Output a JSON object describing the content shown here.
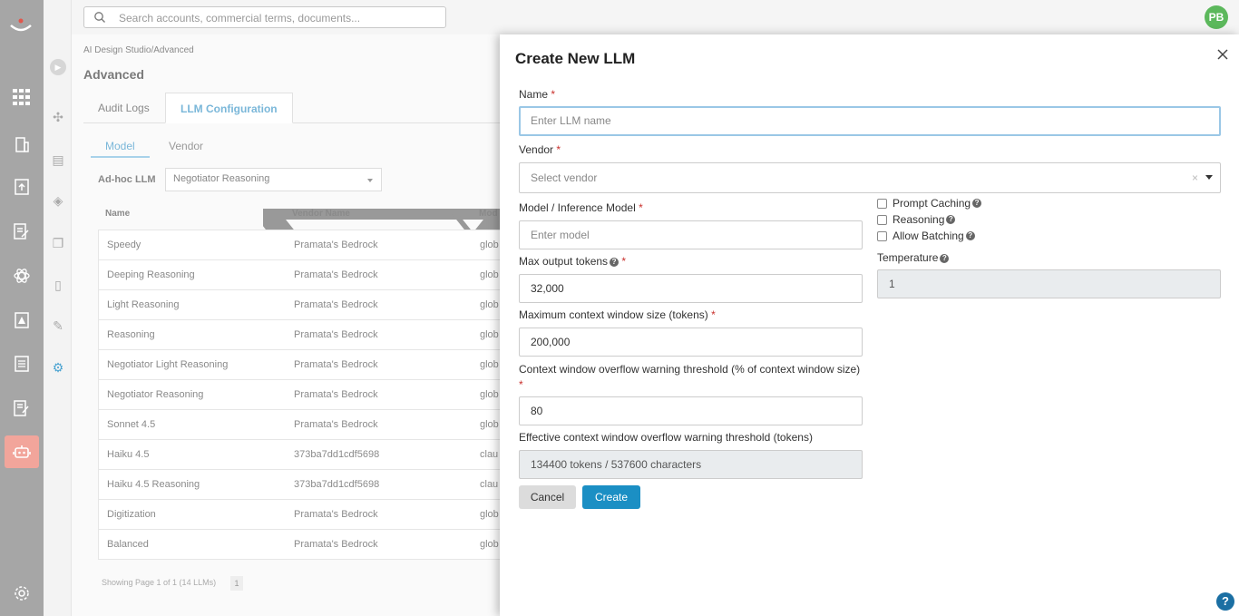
{
  "search": {
    "placeholder": "Search accounts, commercial terms, documents..."
  },
  "user": {
    "initials": "PB"
  },
  "breadcrumb": "AI Design Studio/Advanced",
  "page_title": "Advanced",
  "tabs": [
    {
      "label": "Audit Logs"
    },
    {
      "label": "LLM Configuration"
    }
  ],
  "subtabs": [
    {
      "label": "Model"
    },
    {
      "label": "Vendor"
    }
  ],
  "adhoc": {
    "label": "Ad-hoc LLM",
    "value": "Negotiator Reasoning"
  },
  "table": {
    "headers": [
      "Name",
      "Vendor Name",
      "Mod"
    ],
    "rows": [
      {
        "name": "Speedy",
        "vendor": "Pramata's Bedrock",
        "model": "glob"
      },
      {
        "name": "Deeping Reasoning",
        "vendor": "Pramata's Bedrock",
        "model": "glob"
      },
      {
        "name": "Light Reasoning",
        "vendor": "Pramata's Bedrock",
        "model": "glob"
      },
      {
        "name": "Reasoning",
        "vendor": "Pramata's Bedrock",
        "model": "glob"
      },
      {
        "name": "Negotiator Light Reasoning",
        "vendor": "Pramata's Bedrock",
        "model": "glob"
      },
      {
        "name": "Negotiator Reasoning",
        "vendor": "Pramata's Bedrock",
        "model": "glob"
      },
      {
        "name": "Sonnet 4.5",
        "vendor": "Pramata's Bedrock",
        "model": "glob"
      },
      {
        "name": "Haiku 4.5",
        "vendor": "373ba7dd1cdf5698",
        "model": "clau"
      },
      {
        "name": "Haiku 4.5 Reasoning",
        "vendor": "373ba7dd1cdf5698",
        "model": "clau"
      },
      {
        "name": "Digitization",
        "vendor": "Pramata's Bedrock",
        "model": "glob"
      },
      {
        "name": "Balanced",
        "vendor": "Pramata's Bedrock",
        "model": "glob"
      }
    ],
    "pager_text": "Showing Page 1 of 1 (14 LLMs)",
    "page": "1"
  },
  "modal": {
    "title": "Create New LLM",
    "name": {
      "label": "Name",
      "required": "*",
      "placeholder": "Enter LLM name"
    },
    "vendor": {
      "label": "Vendor",
      "required": "*",
      "placeholder": "Select vendor",
      "clear": "×"
    },
    "model": {
      "label": "Model / Inference Model",
      "required": "*",
      "placeholder": "Enter model"
    },
    "max_output": {
      "label": "Max output tokens",
      "required": "*",
      "value": "32,000"
    },
    "max_context": {
      "label": "Maximum context window size (tokens)",
      "required": "*",
      "value": "200,000"
    },
    "overflow": {
      "label": "Context window overflow warning threshold (% of context window size)",
      "required": "*",
      "value": "80"
    },
    "effective": {
      "label": "Effective context window overflow warning threshold (tokens)",
      "value": "134400 tokens / 537600 characters"
    },
    "checkboxes": [
      {
        "label": "Prompt Caching",
        "checked": false
      },
      {
        "label": "Reasoning",
        "checked": false
      },
      {
        "label": "Allow Batching",
        "checked": false
      }
    ],
    "temperature": {
      "label": "Temperature",
      "value": "1"
    },
    "cancel_label": "Cancel",
    "create_label": "Create",
    "help_glyph": "?",
    "qmark": "?"
  },
  "colors": {
    "primary": "#1b8fc4",
    "avatar": "#5cb85c",
    "active_rail": "#f2a59b",
    "required": "#c9302c"
  }
}
